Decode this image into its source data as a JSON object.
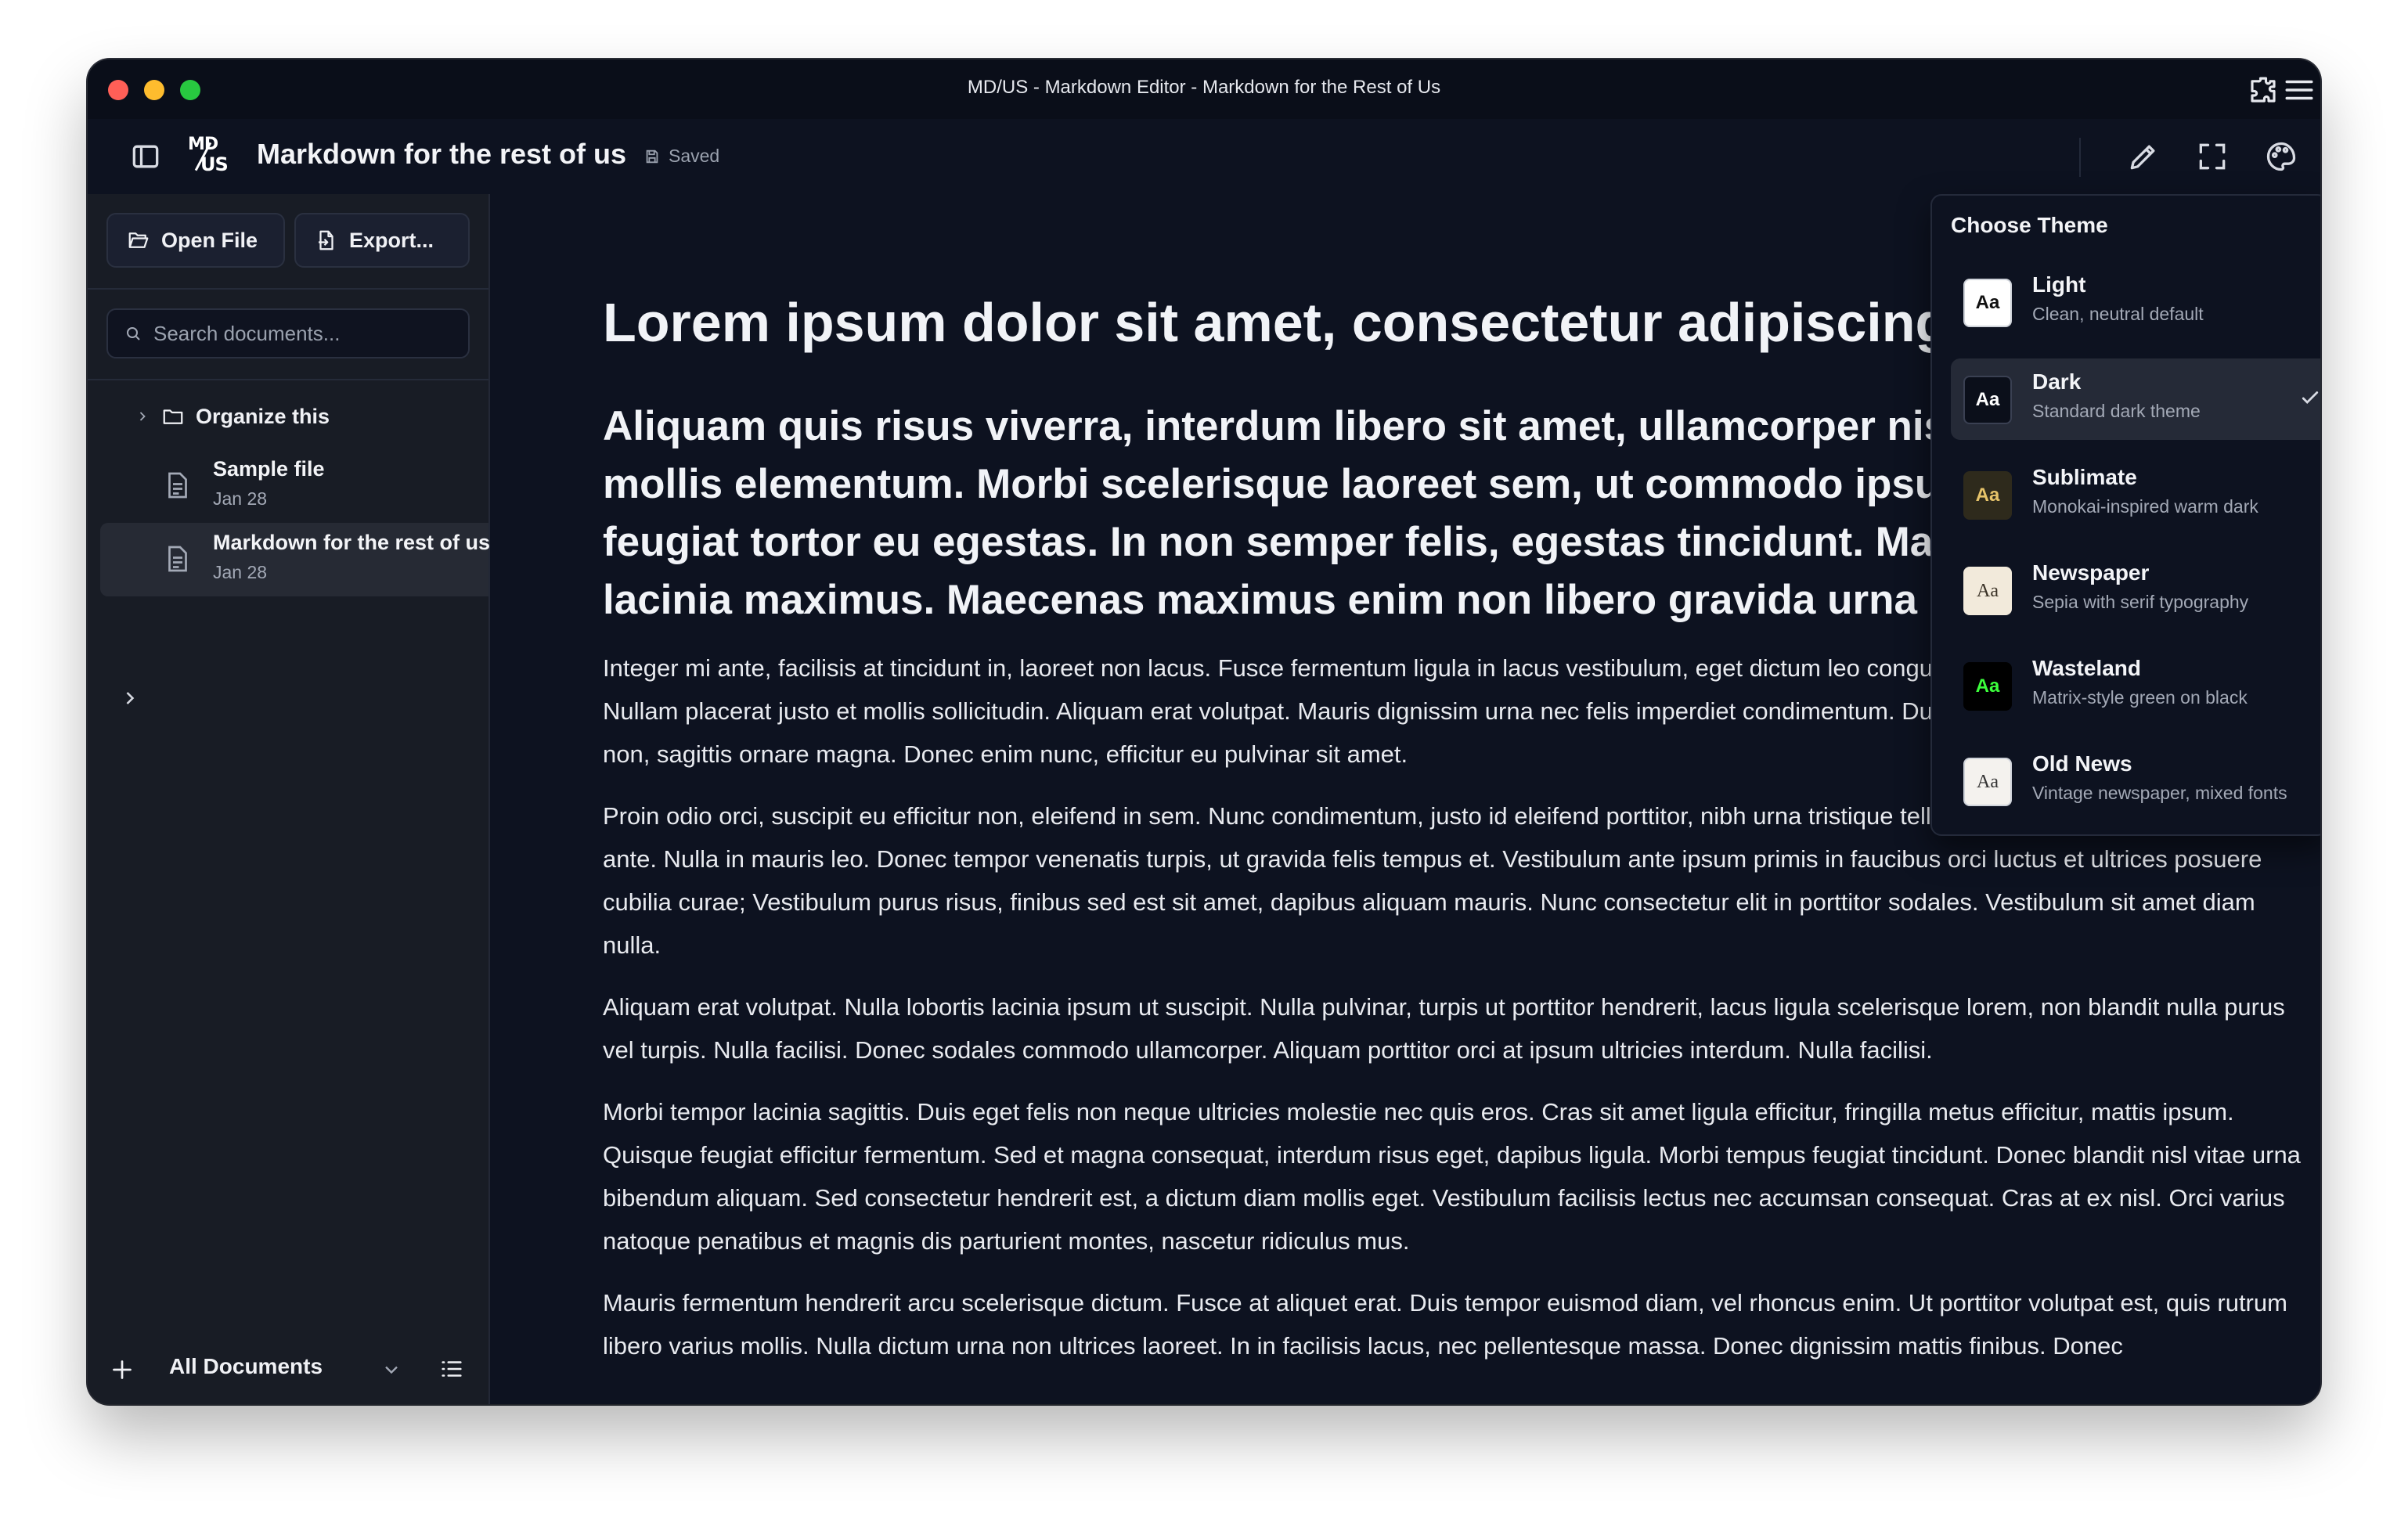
{
  "window": {
    "title": "MD/US - Markdown Editor - Markdown for the Rest of Us"
  },
  "header": {
    "logo_top": "MD",
    "logo_bottom": "US",
    "doc_title": "Markdown for the rest of us",
    "status": "Saved"
  },
  "sidebar": {
    "open_file": "Open File",
    "export": "Export...",
    "search_placeholder": "Search documents...",
    "folder": "Organize this",
    "files": [
      {
        "name": "Sample file",
        "date": "Jan 28"
      },
      {
        "name": "Markdown for the rest of us",
        "date": "Jan 28"
      }
    ],
    "footer_label": "All Documents"
  },
  "document": {
    "h1": "Lorem ipsum dolor sit amet, consectetur adipiscing elit.",
    "h2": "Aliquam quis risus viverra, interdum libero sit amet, ullamcorper nisl. Praesent enim mollis elementum. Morbi scelerisque laoreet sem, ut commodo ipsum. Duis facilisis feugiat tortor eu egestas. In non semper felis, egestas tincidunt. Maecenas cursus lacinia maximus. Maecenas maximus enim non libero gravida urna pharetra.",
    "paragraphs": [
      "Integer mi ante, facilisis at tincidunt in, laoreet non lacus. Fusce fermentum ligula in lacus vestibulum, eget dictum leo congue. Nullam ultricies luctus lorem. Nullam placerat justo et mollis sollicitudin. Aliquam erat volutpat. Mauris dignissim urna nec felis imperdiet condimentum. Duis tortor odio, porttitor eget neque non, sagittis ornare magna. Donec enim nunc, efficitur eu pulvinar sit amet.",
      "Proin odio orci, suscipit eu efficitur non, eleifend in sem. Nunc condimentum, justo id eleifend porttitor, nibh urna tristique tellus, et efficitur felis lorem quis ante. Nulla in mauris leo. Donec tempor venenatis turpis, ut gravida felis tempus et. Vestibulum ante ipsum primis in faucibus orci luctus et ultrices posuere cubilia curae; Vestibulum purus risus, finibus sed est sit amet, dapibus aliquam mauris. Nunc consectetur elit in porttitor sodales. Vestibulum sit amet diam nulla.",
      "Aliquam erat volutpat. Nulla lobortis lacinia ipsum ut suscipit. Nulla pulvinar, turpis ut porttitor hendrerit, lacus ligula scelerisque lorem, non blandit nulla purus vel turpis. Nulla facilisi. Donec sodales commodo ullamcorper. Aliquam porttitor orci at ipsum ultricies interdum. Nulla facilisi.",
      "Morbi tempor lacinia sagittis. Duis eget felis non neque ultricies molestie nec quis eros. Cras sit amet ligula efficitur, fringilla metus efficitur, mattis ipsum. Quisque feugiat efficitur fermentum. Sed et magna consequat, interdum risus eget, dapibus ligula. Morbi tempus feugiat tincidunt. Donec blandit nisl vitae urna bibendum aliquam. Sed consectetur hendrerit est, a dictum diam mollis eget. Vestibulum facilisis lectus nec accumsan consequat. Cras at ex nisl. Orci varius natoque penatibus et magnis dis parturient montes, nascetur ridiculus mus.",
      "Mauris fermentum hendrerit arcu scelerisque dictum. Fusce at aliquet erat. Duis tempor euismod diam, vel rhoncus enim. Ut porttitor volutpat est, quis rutrum libero varius mollis. Nulla dictum urna non ultrices laoreet. In in facilisis lacus, nec pellentesque massa. Donec dignissim mattis finibus. Donec"
    ]
  },
  "theme_menu": {
    "heading": "Choose Theme",
    "selected": "Dark",
    "swatch_label": "Aa",
    "themes": [
      {
        "name": "Light",
        "desc": "Clean, neutral default",
        "bg": "#ffffff",
        "fg": "#111111"
      },
      {
        "name": "Dark",
        "desc": "Standard dark theme",
        "bg": "#0b0f1a",
        "fg": "#ffffff"
      },
      {
        "name": "Sublimate",
        "desc": "Monokai-inspired warm dark",
        "bg": "#2e2a1c",
        "fg": "#e6c36a"
      },
      {
        "name": "Newspaper",
        "desc": "Sepia with serif typography",
        "bg": "#f2eadb",
        "fg": "#3a3226"
      },
      {
        "name": "Wasteland",
        "desc": "Matrix-style green on black",
        "bg": "#000000",
        "fg": "#3cff3c"
      },
      {
        "name": "Old News",
        "desc": "Vintage newspaper, mixed fonts",
        "bg": "#f4f2ee",
        "fg": "#333333"
      }
    ]
  }
}
